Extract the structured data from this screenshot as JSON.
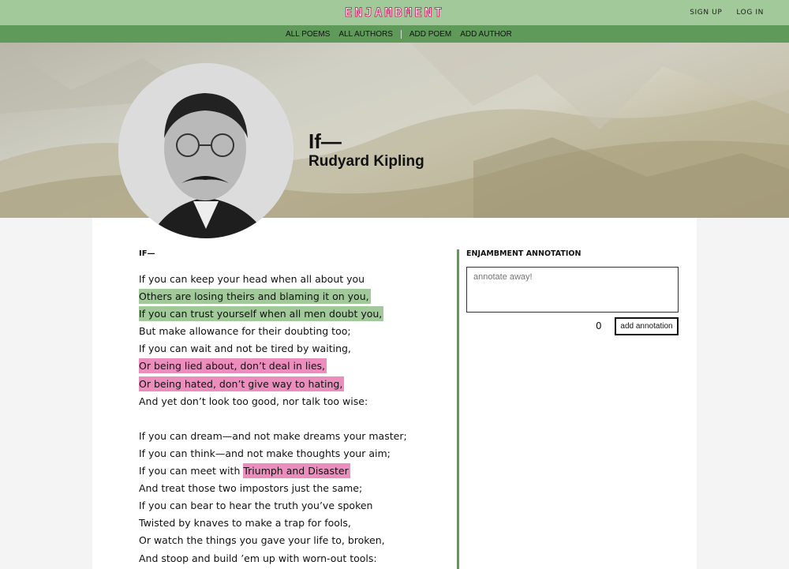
{
  "header": {
    "logo": "ENJAMBMENT",
    "sign_up": "SIGN UP",
    "log_in": "LOG IN"
  },
  "nav": {
    "all_poems": "ALL POEMS",
    "all_authors": "ALL AUTHORS",
    "add_poem": "ADD POEM",
    "add_author": "ADD AUTHOR"
  },
  "poem": {
    "title": "If—",
    "author": "Rudyard Kipling",
    "heading": "IF—",
    "lines": [
      {
        "text": "If you can keep your head when all about you"
      },
      {
        "text": "Others are losing theirs and blaming it on you,",
        "highlight": "green"
      },
      {
        "text": "If you can trust yourself when all men doubt you,",
        "highlight": "green"
      },
      {
        "text": "But make allowance for their doubting too;"
      },
      {
        "text": "If you can wait and not be tired by waiting,"
      },
      {
        "text": "Or being lied about, don’t deal in lies,",
        "highlight": "pink"
      },
      {
        "text": "Or being hated, don’t give way to hating,",
        "highlight": "pink"
      },
      {
        "text": "And yet don’t look too good, nor talk too wise:"
      },
      {
        "text": ""
      },
      {
        "text": "If you can dream—and not make dreams your master;"
      },
      {
        "text": "If you can think—and not make thoughts your aim;"
      },
      {
        "text": "If you can meet with ",
        "highlight_text": "Triumph and Disaster",
        "highlight": "pink"
      },
      {
        "text": "And treat those two impostors just the same;"
      },
      {
        "text": "If you can bear to hear the truth you’ve spoken"
      },
      {
        "text": "Twisted by knaves to make a trap for fools,"
      },
      {
        "text": "Or watch the things you gave your life to, broken,"
      },
      {
        "text": "And stoop and build ’em up with worn-out tools:"
      }
    ]
  },
  "annotation": {
    "heading": "ENJAMBMENT ANNOTATION",
    "placeholder": "annotate away!",
    "count": "0",
    "button": "add annotation"
  },
  "colors": {
    "header_bg": "#a1c99a",
    "nav_bg": "#5f9a5b",
    "logo_outline": "#c8336a",
    "highlight_green": "#a1c99a",
    "highlight_pink": "#ec8ebd"
  }
}
